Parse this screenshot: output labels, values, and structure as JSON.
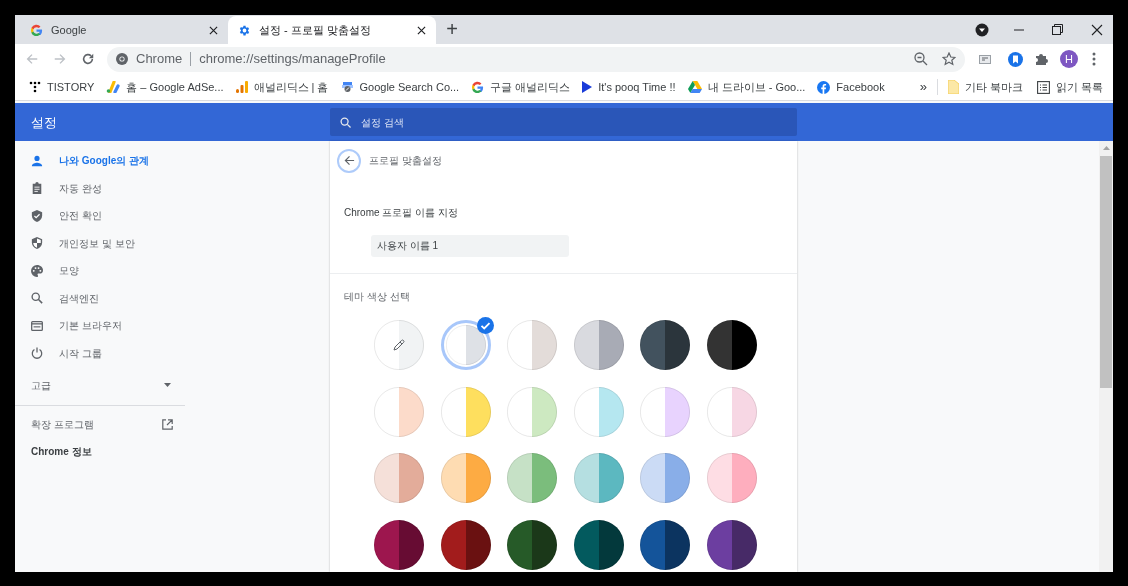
{
  "tabs": [
    {
      "title": "Google",
      "kind": "google",
      "selected": false
    },
    {
      "title": "설정 - 프로필 맞춤설정",
      "kind": "settings",
      "selected": true
    }
  ],
  "new_tab": "+",
  "address_bar": {
    "site": "Chrome",
    "url": "chrome://settings/manageProfile"
  },
  "avatar": "H",
  "bookmarks": [
    {
      "label": "TISTORY",
      "kind": "tistory"
    },
    {
      "label": "홈 – Google AdSe...",
      "kind": "adsense"
    },
    {
      "label": "애널리딕스 | 홈",
      "kind": "analytics"
    },
    {
      "label": "Google Search Co...",
      "kind": "console"
    },
    {
      "label": "구글 애널리딕스",
      "kind": "google"
    },
    {
      "label": "It's pooq Time !!",
      "kind": "pooq"
    },
    {
      "label": "내 드라이브 - Goo...",
      "kind": "drive"
    },
    {
      "label": "Facebook",
      "kind": "facebook"
    }
  ],
  "bookmarks_more": "»",
  "other_bookmarks": [
    {
      "label": "기타 북마크",
      "kind": "folder"
    },
    {
      "label": "읽기 목록",
      "kind": "reading"
    }
  ],
  "header": {
    "title": "설정",
    "search_placeholder": "설정 검색"
  },
  "sidebar": {
    "items": [
      {
        "label": "나와 Google의 관계",
        "kind": "person",
        "selected": true
      },
      {
        "label": "자동 완성",
        "kind": "clipboard",
        "selected": false
      },
      {
        "label": "안전 확인",
        "kind": "shield_check",
        "selected": false
      },
      {
        "label": "개인정보 및 보안",
        "kind": "shield_half",
        "selected": false
      },
      {
        "label": "모양",
        "kind": "palette",
        "selected": false
      },
      {
        "label": "검색엔진",
        "kind": "search",
        "selected": false
      },
      {
        "label": "기본 브라우저",
        "kind": "browser",
        "selected": false
      },
      {
        "label": "시작 그룹",
        "kind": "power",
        "selected": false
      }
    ],
    "advanced": {
      "label": "고급",
      "expanded": false
    },
    "extensions": "확장 프로그램",
    "about": "Chrome 정보"
  },
  "page": {
    "title": "프로필 맞춤설정",
    "name_label": "Chrome 프로필 이름 지정",
    "name_value": "사용자 이름 1",
    "theme_label": "테마 색상 선택",
    "themes": [
      {
        "kind": "picker",
        "halves": [
          {
            "color": "#ffffff"
          },
          {
            "color": "#f1f3f4"
          }
        ],
        "selected": false
      },
      {
        "kind": "swatch",
        "halves": [
          {
            "color": "#ffffff"
          },
          {
            "color": "#dee1e6"
          }
        ],
        "selected": true
      },
      {
        "kind": "swatch",
        "halves": [
          {
            "color": "#ffffff"
          },
          {
            "color": "#e3dcd9"
          }
        ],
        "selected": false
      },
      {
        "kind": "swatch",
        "halves": [
          {
            "color": "#d9dadf"
          },
          {
            "color": "#a8abb5"
          }
        ],
        "selected": false
      },
      {
        "kind": "swatch",
        "halves": [
          {
            "color": "#42525e"
          },
          {
            "color": "#2b353c"
          }
        ],
        "selected": false
      },
      {
        "kind": "swatch",
        "halves": [
          {
            "color": "#333333"
          },
          {
            "color": "#000000"
          }
        ],
        "selected": false
      },
      {
        "kind": "swatch",
        "halves": [
          {
            "color": "#ffffff"
          },
          {
            "color": "#fcdbca"
          }
        ],
        "selected": false
      },
      {
        "kind": "swatch",
        "halves": [
          {
            "color": "#ffffff"
          },
          {
            "color": "#fedf5e"
          }
        ],
        "selected": false
      },
      {
        "kind": "swatch",
        "halves": [
          {
            "color": "#ffffff"
          },
          {
            "color": "#cde9c1"
          }
        ],
        "selected": false
      },
      {
        "kind": "swatch",
        "halves": [
          {
            "color": "#ffffff"
          },
          {
            "color": "#b5e7f0"
          }
        ],
        "selected": false
      },
      {
        "kind": "swatch",
        "halves": [
          {
            "color": "#ffffff"
          },
          {
            "color": "#e8d3fe"
          }
        ],
        "selected": false
      },
      {
        "kind": "swatch",
        "halves": [
          {
            "color": "#ffffff"
          },
          {
            "color": "#f7d7e4"
          }
        ],
        "selected": false
      },
      {
        "kind": "swatch",
        "halves": [
          {
            "color": "#f5e0d9"
          },
          {
            "color": "#e3ac9a"
          }
        ],
        "selected": false
      },
      {
        "kind": "swatch",
        "halves": [
          {
            "color": "#fedcb2"
          },
          {
            "color": "#fdab43"
          }
        ],
        "selected": false
      },
      {
        "kind": "swatch",
        "halves": [
          {
            "color": "#c6e1c6"
          },
          {
            "color": "#7bbd7c"
          }
        ],
        "selected": false
      },
      {
        "kind": "swatch",
        "halves": [
          {
            "color": "#b5dfe1"
          },
          {
            "color": "#5cb8c0"
          }
        ],
        "selected": false
      },
      {
        "kind": "swatch",
        "halves": [
          {
            "color": "#cbdbf5"
          },
          {
            "color": "#89aee8"
          }
        ],
        "selected": false
      },
      {
        "kind": "swatch",
        "halves": [
          {
            "color": "#fedde4"
          },
          {
            "color": "#feaebe"
          }
        ],
        "selected": false
      },
      {
        "kind": "swatch",
        "halves": [
          {
            "color": "#9d164e"
          },
          {
            "color": "#670c33"
          }
        ],
        "selected": false
      },
      {
        "kind": "swatch",
        "halves": [
          {
            "color": "#a21c1c"
          },
          {
            "color": "#6a1111"
          }
        ],
        "selected": false
      },
      {
        "kind": "swatch",
        "halves": [
          {
            "color": "#265a28"
          },
          {
            "color": "#1b3819"
          }
        ],
        "selected": false
      },
      {
        "kind": "swatch",
        "halves": [
          {
            "color": "#035a5e"
          },
          {
            "color": "#03393c"
          }
        ],
        "selected": false
      },
      {
        "kind": "swatch",
        "halves": [
          {
            "color": "#14549a"
          },
          {
            "color": "#0c3460"
          }
        ],
        "selected": false
      },
      {
        "kind": "swatch",
        "halves": [
          {
            "color": "#6c3ea0"
          },
          {
            "color": "#472a67"
          }
        ],
        "selected": false
      }
    ]
  }
}
